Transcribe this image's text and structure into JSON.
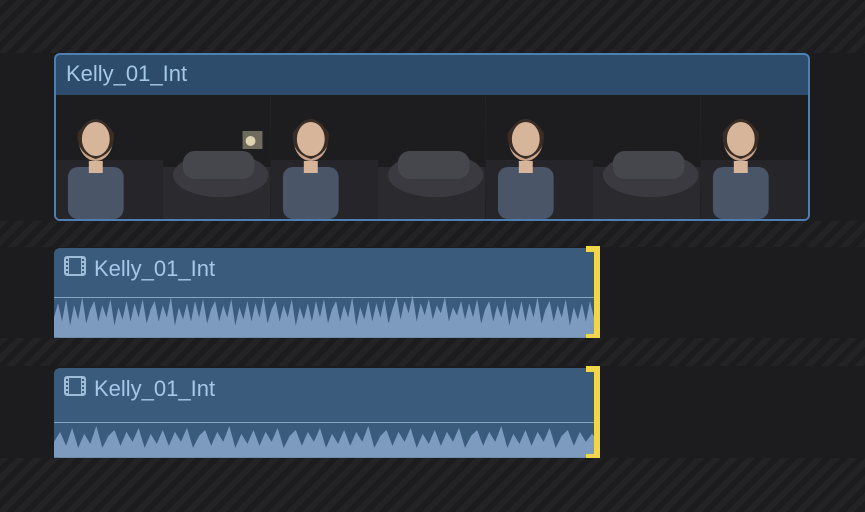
{
  "video_clip": {
    "name": "Kelly_01_Int",
    "thumb_count": 7
  },
  "audio_clips": [
    {
      "name": "Kelly_01_Int",
      "selected_edge": "right"
    },
    {
      "name": "Kelly_01_Int",
      "selected_edge": "right"
    }
  ],
  "colors": {
    "clip_border": "#4d7fb3",
    "clip_fill": "#3b5b7d",
    "edit_highlight": "#f0d648"
  }
}
